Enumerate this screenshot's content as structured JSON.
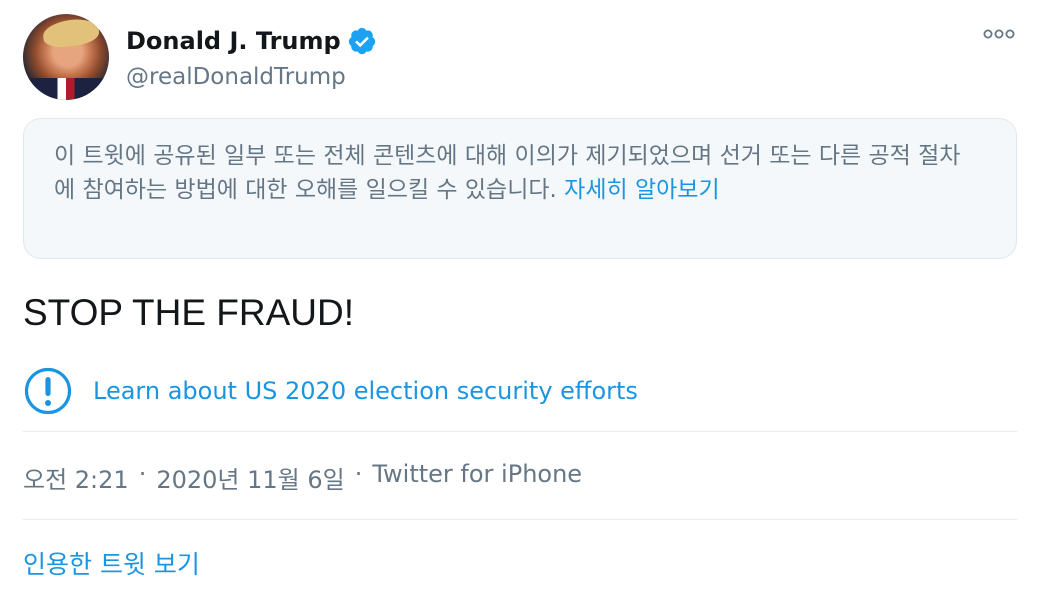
{
  "author": {
    "name": "Donald J. Trump",
    "handle": "@realDonaldTrump",
    "avatar_icon": "profile-photo",
    "verified_icon": "verified-badge-icon",
    "more_icon": "more-options-icon"
  },
  "notice": {
    "text": "이 트윗에 공유된 일부 또는 전체 콘텐츠에 대해 이의가 제기되었으며 선거 또는 다른 공적 절차에 참여하는 방법에 대한 오해를 일으킬 수 있습니다. ",
    "link": "자세히 알아보기"
  },
  "tweet": {
    "text": "STOP THE FRAUD!"
  },
  "election_notice": {
    "icon": "exclamation-circle-icon",
    "label": "Learn about US 2020 election security efforts"
  },
  "meta": {
    "time": "오전 2:21",
    "separator": "·",
    "date": "2020년 11월 6일",
    "source": "Twitter for iPhone"
  },
  "quote_link": "인용한 트윗 보기",
  "colors": {
    "accent": "#1b95e0",
    "secondary_text": "#657786",
    "notice_background": "#f5f8fa"
  }
}
